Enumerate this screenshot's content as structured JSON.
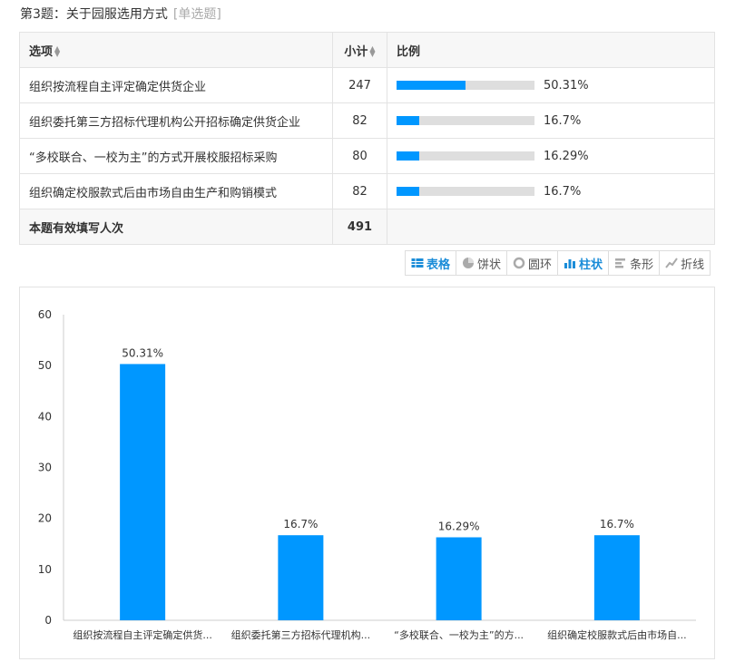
{
  "question": {
    "title": "第3题：关于园服选用方式",
    "type_tag": "[单选题]"
  },
  "table": {
    "headers": {
      "option": "选项",
      "count": "小计",
      "ratio": "比例"
    },
    "rows": [
      {
        "option": "组织按流程自主评定确定供货企业",
        "count": "247",
        "percent_label": "50.31%",
        "percent": 50.31
      },
      {
        "option": "组织委托第三方招标代理机构公开招标确定供货企业",
        "count": "82",
        "percent_label": "16.7%",
        "percent": 16.7
      },
      {
        "option": "“多校联合、一校为主”的方式开展校服招标采购",
        "count": "80",
        "percent_label": "16.29%",
        "percent": 16.29
      },
      {
        "option": "组织确定校服款式后由市场自由生产和购销模式",
        "count": "82",
        "percent_label": "16.7%",
        "percent": 16.7
      }
    ],
    "total": {
      "label": "本题有效填写人次",
      "count": "491"
    }
  },
  "view_switch": {
    "items": [
      {
        "label": "表格",
        "icon": "table-icon",
        "active": true
      },
      {
        "label": "饼状",
        "icon": "pie-icon",
        "active": false
      },
      {
        "label": "圆环",
        "icon": "ring-icon",
        "active": false
      },
      {
        "label": "柱状",
        "icon": "bar-chart-icon",
        "active": true
      },
      {
        "label": "条形",
        "icon": "bar-horizontal-icon",
        "active": false
      },
      {
        "label": "折线",
        "icon": "line-chart-icon",
        "active": false
      }
    ]
  },
  "colors": {
    "accent": "#0097ff",
    "active_text": "#1a8cd8",
    "track": "#dedede"
  },
  "chart_data": {
    "type": "bar",
    "categories": [
      "组织按流程自主评定确定供货...",
      "组织委托第三方招标代理机构...",
      "“多校联合、一校为主”的方...",
      "组织确定校服款式后由市场自..."
    ],
    "values": [
      50.31,
      16.7,
      16.29,
      16.7
    ],
    "value_labels": [
      "50.31%",
      "16.7%",
      "16.29%",
      "16.7%"
    ],
    "ylim": [
      0,
      60
    ],
    "yticks": [
      "0",
      "10",
      "20",
      "30",
      "40",
      "50",
      "60"
    ],
    "grid": false,
    "color": "#0097ff"
  }
}
